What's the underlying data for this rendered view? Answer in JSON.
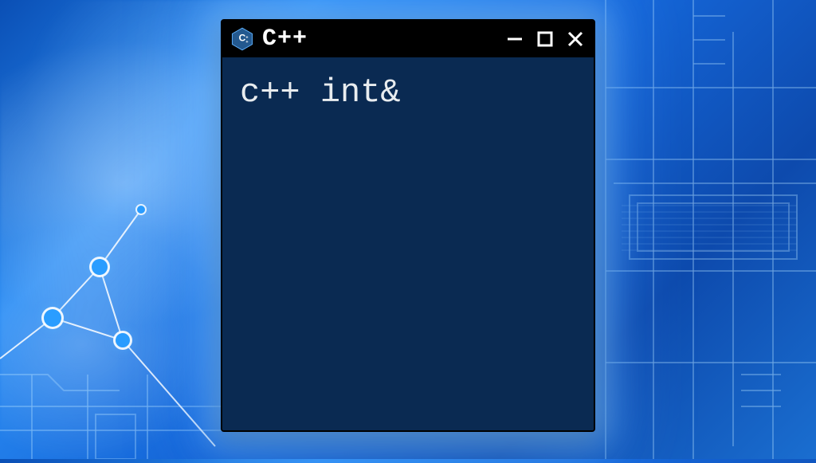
{
  "window": {
    "title": "C++",
    "icon": "cpp-hex-icon",
    "controls": {
      "minimize": "minimize",
      "maximize": "maximize",
      "close": "close"
    }
  },
  "terminal": {
    "line1": "c++ int&"
  },
  "colors": {
    "terminal_bg": "#0a2a52",
    "titlebar_bg": "#000000",
    "text": "#e8ecef",
    "glow": "#6ab8ff"
  }
}
